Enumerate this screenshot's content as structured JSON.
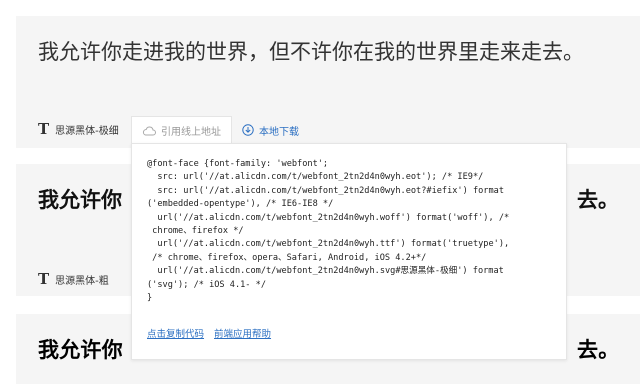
{
  "cards": [
    {
      "sample_text": "我允许你走进我的世界，但不许你在我的世界里走来走去。",
      "font_name": "思源黑体-极细"
    },
    {
      "sample_left": "我允许你",
      "sample_right": "去。",
      "font_name": "思源黑体-粗"
    },
    {
      "sample_left": "我允许你",
      "sample_right": "去。"
    }
  ],
  "tabs": {
    "online_label": "引用线上地址",
    "download_label": "本地下载"
  },
  "code_lines": [
    "@font-face {font-family: 'webfont';",
    "  src: url('//at.alicdn.com/t/webfont_2tn2d4n0wyh.eot'); /* IE9*/",
    "  src: url('//at.alicdn.com/t/webfont_2tn2d4n0wyh.eot?#iefix') format",
    "('embedded-opentype'), /* IE6-IE8 */",
    "  url('//at.alicdn.com/t/webfont_2tn2d4n0wyh.woff') format('woff'), /*",
    " chrome、firefox */",
    "  url('//at.alicdn.com/t/webfont_2tn2d4n0wyh.ttf') format('truetype'),",
    " /* chrome、firefox、opera、Safari, Android, iOS 4.2+*/",
    "  url('//at.alicdn.com/t/webfont_2tn2d4n0wyh.svg#思源黑体-极细') format",
    "('svg'); /* iOS 4.1- */",
    "}"
  ],
  "links": {
    "copy_code": "点击复制代码",
    "help": "前端应用帮助"
  },
  "colors": {
    "link": "#2b6fc2",
    "card_bg": "#f5f5f5"
  }
}
